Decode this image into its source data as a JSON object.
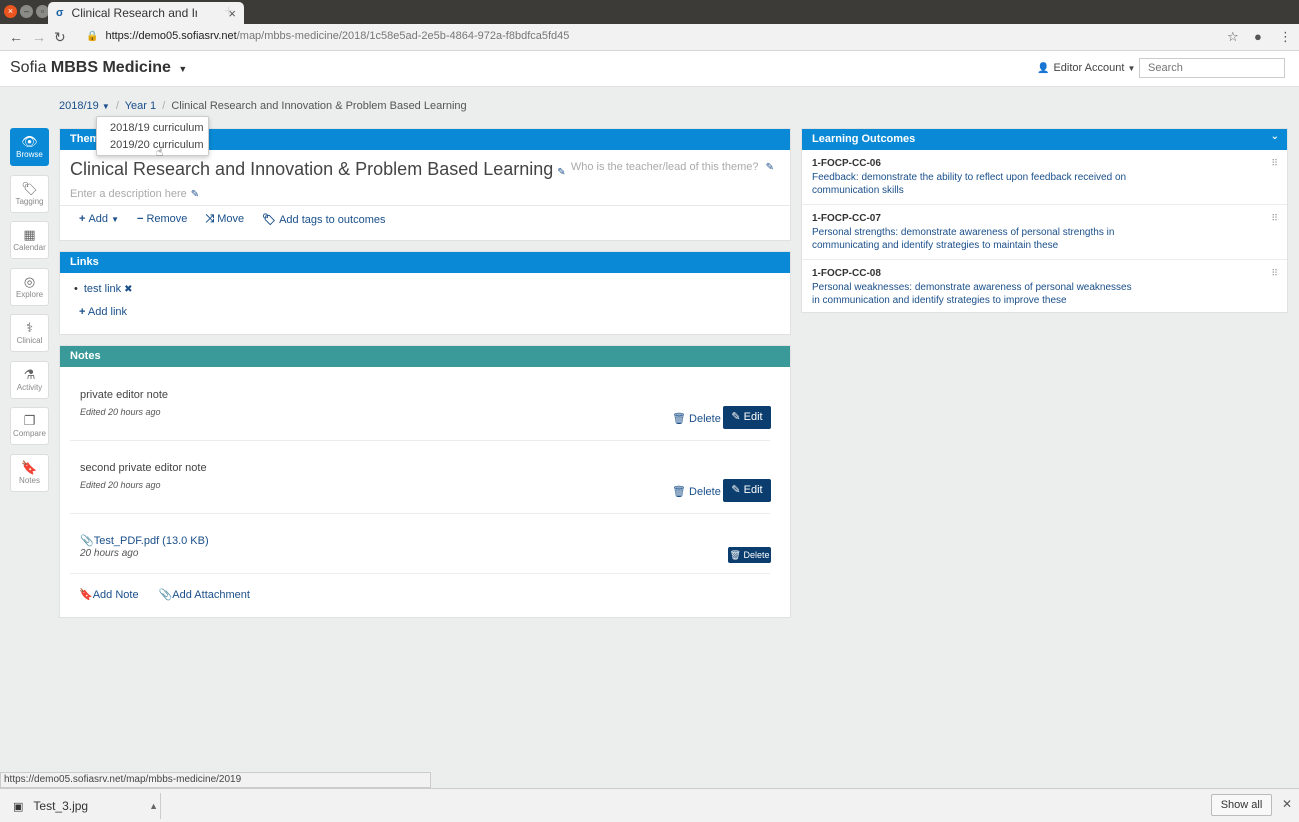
{
  "browser": {
    "tab_title": "Clinical Research and Innovation & Problem Based Learning",
    "url_host": "https://demo05.sofiasrv.net",
    "url_path": "/map/mbbs-medicine/2018/1c58e5ad-2e5b-4864-972a-f8bdfca5fd45",
    "status_url": "https://demo05.sofiasrv.net/map/mbbs-medicine/2019"
  },
  "app": {
    "brand_prefix": "Sofia",
    "brand_name": "MBBS Medicine",
    "account_label": "Editor Account",
    "search_placeholder": "Search"
  },
  "breadcrumb": {
    "year": "2018/19",
    "level": "Year 1",
    "current": "Clinical Research and Innovation & Problem Based Learning"
  },
  "dropdown": {
    "options": [
      "2018/19 curriculum",
      "2019/20 curriculum"
    ]
  },
  "sidebar": {
    "items": [
      {
        "label": "Browse",
        "icon": "eye-icon"
      },
      {
        "label": "Tagging",
        "icon": "tags-icon"
      },
      {
        "label": "Calendar",
        "icon": "calendar-icon"
      },
      {
        "label": "Explore",
        "icon": "compass-icon"
      },
      {
        "label": "Clinical",
        "icon": "doctor-icon"
      },
      {
        "label": "Activity",
        "icon": "flask-icon"
      },
      {
        "label": "Compare",
        "icon": "copy-icon"
      },
      {
        "label": "Notes",
        "icon": "bookmark-icon"
      }
    ]
  },
  "theme": {
    "header": "Theme",
    "title": "Clinical Research and Innovation & Problem Based Learning",
    "lead_placeholder": "Who is the teacher/lead of this theme?",
    "description_placeholder": "Enter a description here",
    "actions": {
      "add": "Add",
      "remove": "Remove",
      "move": "Move",
      "tag": "Add tags to outcomes"
    }
  },
  "links": {
    "header": "Links",
    "items": [
      "test link"
    ],
    "add_label": "Add link"
  },
  "notes": {
    "header": "Notes",
    "items": [
      {
        "text": "private editor note",
        "meta": "Edited 20 hours ago"
      },
      {
        "text": "second private editor note",
        "meta": "Edited 20 hours ago"
      }
    ],
    "attachment": {
      "name": "Test_PDF.pdf (13.0 KB)",
      "time": "20 hours ago"
    },
    "delete_label": "Delete",
    "edit_label": "Edit",
    "add_note": "Add Note",
    "add_attachment": "Add Attachment"
  },
  "outcomes": {
    "header": "Learning Outcomes",
    "items": [
      {
        "code": "1-FOCP-CC-06",
        "text": "Feedback: demonstrate the ability to reflect upon feedback received on communication skills"
      },
      {
        "code": "1-FOCP-CC-07",
        "text": "Personal strengths: demonstrate awareness of personal strengths in communicating and identify strategies to maintain these"
      },
      {
        "code": "1-FOCP-CC-08",
        "text": "Personal weaknesses: demonstrate awareness of personal weaknesses in communication and identify strategies to improve these"
      }
    ]
  },
  "downloads": {
    "file": "Test_3.jpg",
    "show_all": "Show all"
  }
}
